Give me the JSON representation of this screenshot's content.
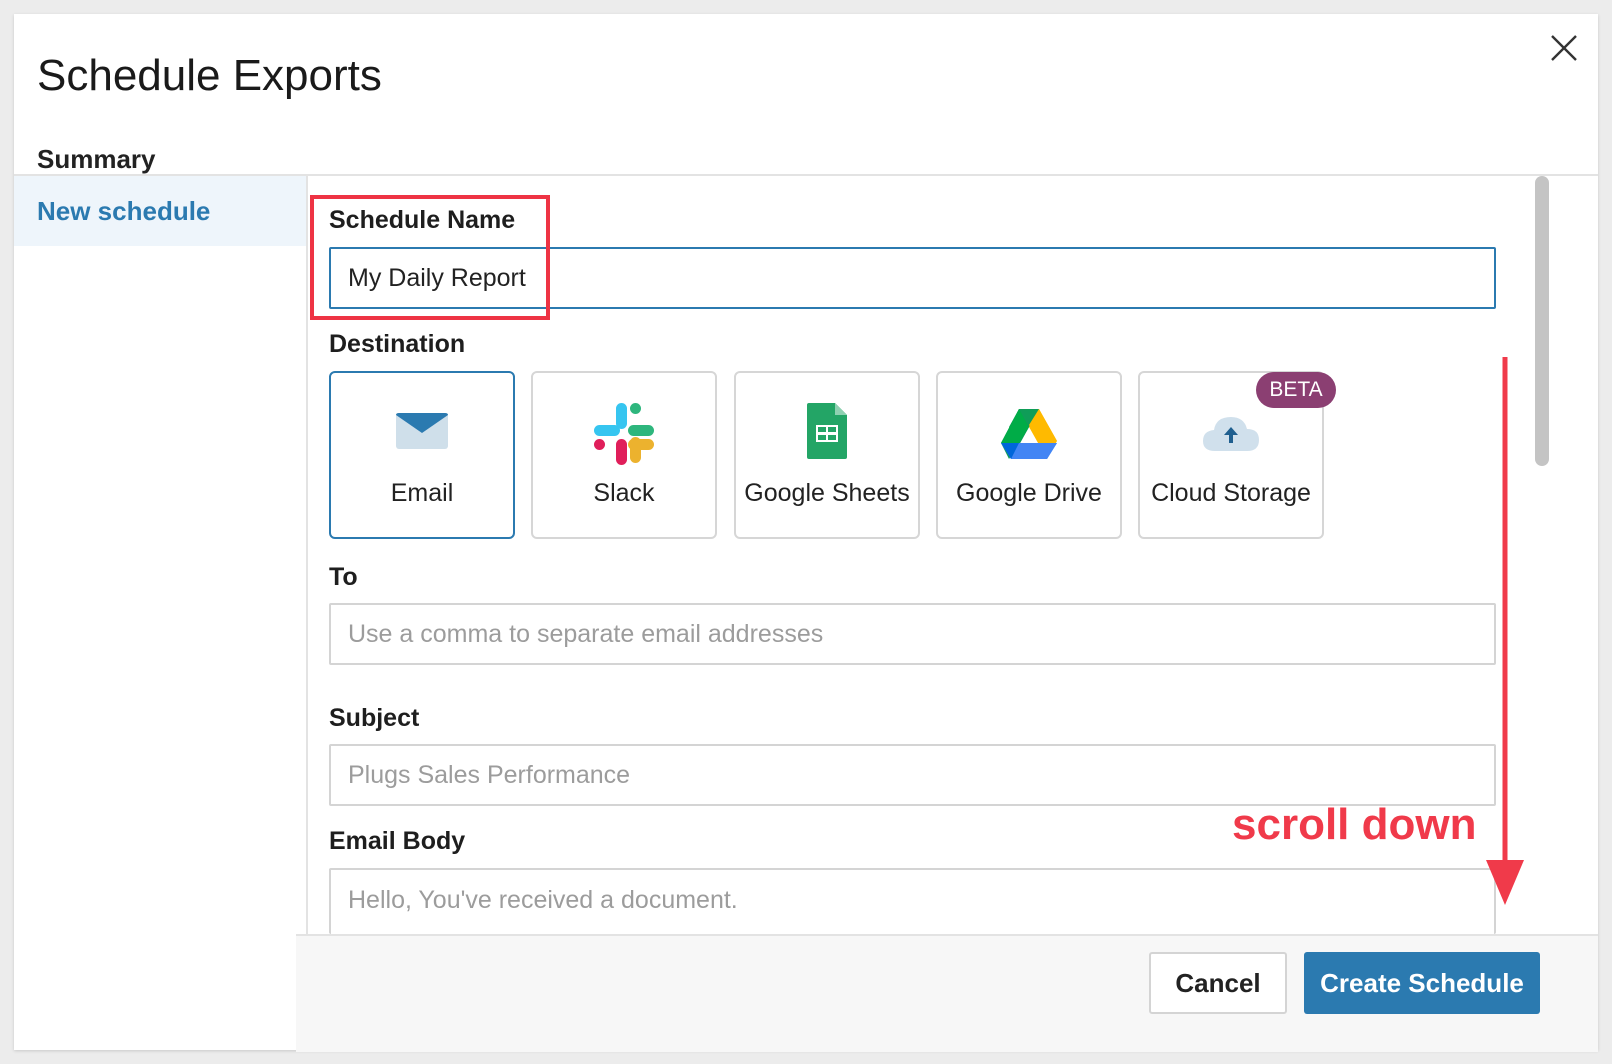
{
  "dialog": {
    "title": "Schedule Exports",
    "summary_label": "Summary",
    "close_icon": "close-icon"
  },
  "sidebar": {
    "items": [
      {
        "label": "New schedule",
        "selected": true
      }
    ]
  },
  "form": {
    "schedule_name": {
      "label": "Schedule Name",
      "value": "My Daily Report"
    },
    "destination": {
      "label": "Destination",
      "options": [
        {
          "label": "Email",
          "icon": "envelope-icon",
          "selected": true
        },
        {
          "label": "Slack",
          "icon": "slack-icon",
          "selected": false
        },
        {
          "label": "Google Sheets",
          "icon": "google-sheets-icon",
          "selected": false
        },
        {
          "label": "Google Drive",
          "icon": "google-drive-icon",
          "selected": false
        },
        {
          "label": "Cloud Storage",
          "icon": "cloud-upload-icon",
          "selected": false,
          "badge": "BETA"
        }
      ]
    },
    "to": {
      "label": "To",
      "placeholder": "Use a comma to separate email addresses",
      "value": ""
    },
    "subject": {
      "label": "Subject",
      "placeholder": "Plugs Sales Performance",
      "value": ""
    },
    "email_body": {
      "label": "Email Body",
      "placeholder": "Hello, You've received a document.",
      "value": ""
    }
  },
  "footer": {
    "cancel_label": "Cancel",
    "create_label": "Create Schedule"
  },
  "annotation": {
    "text": "scroll down"
  },
  "colors": {
    "accent": "#2b7ab0",
    "beta_badge": "#8b3f72",
    "annotation_red": "#f03a4a"
  }
}
